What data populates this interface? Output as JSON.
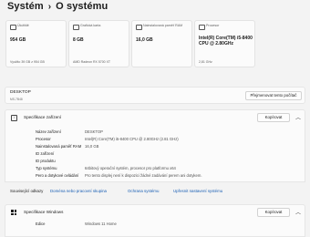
{
  "breadcrumb": {
    "parent": "Systém",
    "separator": "›",
    "current": "O systému"
  },
  "cards": [
    {
      "label": "Úložiště",
      "value": "954 GB",
      "sub": "Využito 39 GB z 954 GB"
    },
    {
      "label": "Grafická karta",
      "value": "8 GB",
      "sub": "AMD Radeon RX 5700 XT"
    },
    {
      "label": "Nainstalovaná paměť RAM",
      "value": "16,0 GB",
      "sub": ""
    },
    {
      "label": "Procesor",
      "value": "Intel(R) Core(TM) i5-8400 CPU @ 2.80GHz",
      "sub": "2,81 GHz"
    }
  ],
  "device": {
    "name": "DESKTOP",
    "model": "MS-7B48",
    "rename_label": "Přejmenovat tento počítač"
  },
  "specs": {
    "title": "Specifikace zařízení",
    "copy_label": "Kopírovat",
    "rows": [
      {
        "key": "Název zařízení",
        "value": "DESKTOP"
      },
      {
        "key": "Procesor",
        "value": "Intel(R) Core(TM) i5-8400 CPU @ 2.80GHz (2.81 GHz)"
      },
      {
        "key": "Nainstalovaná paměť RAM",
        "value": "16,0 GB"
      },
      {
        "key": "ID zařízení",
        "value": ""
      },
      {
        "key": "ID produktu",
        "value": ""
      },
      {
        "key": "Typ systému",
        "value": "64bitový operační systém, procesor pro platformu x64"
      },
      {
        "key": "Pero a dotykové ovládání",
        "value": "Pro tento displej není k dispozici žádné zadávání perem ani dotykem."
      }
    ]
  },
  "related": {
    "label": "Související odkazy",
    "links": [
      "Doména nebo pracovní skupina",
      "Ochrana systému",
      "Upřesnit nastavení systému"
    ]
  },
  "windows": {
    "title": "Specifikace Windows",
    "copy_label": "Kopírovat",
    "rows": [
      {
        "key": "Edice",
        "value": "Windows 11 Home"
      }
    ]
  }
}
